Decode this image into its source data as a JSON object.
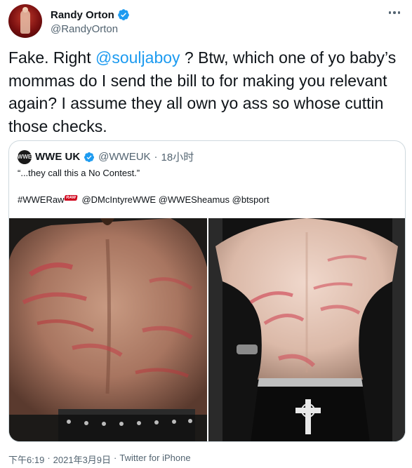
{
  "author": {
    "display_name": "Randy Orton",
    "handle": "@RandyOrton",
    "verified_icon": "verified-badge-icon"
  },
  "tweet": {
    "text_before": "Fake. Right ",
    "mention": "@souljaboy",
    "text_after": " ? Btw, which one of yo baby’s mommas do I send the bill to for making you relevant again? I assume they all own yo ass so whose cuttin those checks."
  },
  "quoted": {
    "display_name": "WWE UK",
    "handle": "@WWEUK",
    "separator": "·",
    "time": "18小时",
    "avatar_text": "WWE",
    "line1": "“...they call this a No Contest.”",
    "hashtag": "#WWERaw",
    "badge": "RAW",
    "mentions": " @DMcIntyreWWE @WWESheamus @btsport"
  },
  "footer": {
    "time": "下午6:19",
    "separator": "·",
    "date": "2021年3月9日",
    "separator2": "·",
    "source": "Twitter for iPhone"
  },
  "colors": {
    "accent": "#1d9bf0",
    "text": "#0f1419",
    "muted": "#536471",
    "border": "#cfd9de"
  }
}
